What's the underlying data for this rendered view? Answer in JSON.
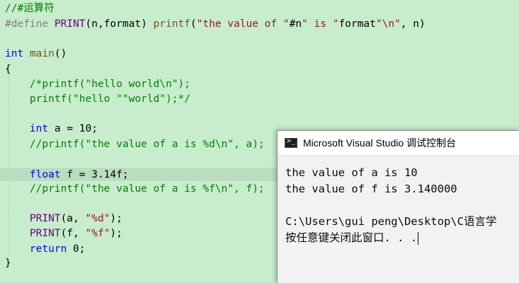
{
  "editor": {
    "lines": [
      {
        "tokens": [
          {
            "cls": "cm",
            "text": "//#运算符"
          }
        ]
      },
      {
        "tokens": [
          {
            "cls": "pp",
            "text": "#define "
          },
          {
            "cls": "mac",
            "text": "PRINT"
          },
          {
            "cls": "op",
            "text": "(n,format) "
          },
          {
            "cls": "fn",
            "text": "printf"
          },
          {
            "cls": "op",
            "text": "("
          },
          {
            "cls": "str",
            "text": "\"the value of \""
          },
          {
            "cls": "op",
            "text": "#n"
          },
          {
            "cls": "str",
            "text": "\" is \""
          },
          {
            "cls": "op",
            "text": "format"
          },
          {
            "cls": "str",
            "text": "\"\\n\""
          },
          {
            "cls": "op",
            "text": ", n)"
          }
        ]
      },
      {
        "tokens": []
      },
      {
        "tokens": [
          {
            "cls": "kw",
            "text": "int"
          },
          {
            "cls": "op",
            "text": " "
          },
          {
            "cls": "fn",
            "text": "main"
          },
          {
            "cls": "op",
            "text": "()"
          }
        ]
      },
      {
        "tokens": [
          {
            "cls": "op",
            "text": "{"
          }
        ]
      },
      {
        "tokens": [
          {
            "cls": "cm",
            "text": "    /*printf(\"hello world\\n\");"
          }
        ]
      },
      {
        "tokens": [
          {
            "cls": "cm",
            "text": "    printf(\"hello \"\"world\");*/"
          }
        ]
      },
      {
        "tokens": []
      },
      {
        "tokens": [
          {
            "cls": "op",
            "text": "    "
          },
          {
            "cls": "kw",
            "text": "int"
          },
          {
            "cls": "op",
            "text": " a = 10;"
          }
        ]
      },
      {
        "tokens": [
          {
            "cls": "cm",
            "text": "    //printf(\"the value of a is %d\\n\", a);"
          }
        ]
      },
      {
        "tokens": []
      },
      {
        "tokens": [
          {
            "cls": "op",
            "text": "    "
          },
          {
            "cls": "kw",
            "text": "float"
          },
          {
            "cls": "op",
            "text": " f = 3.14f;"
          }
        ],
        "highlight": true
      },
      {
        "tokens": [
          {
            "cls": "cm",
            "text": "    //printf(\"the value of a is %f\\n\", f);"
          }
        ]
      },
      {
        "tokens": []
      },
      {
        "tokens": [
          {
            "cls": "op",
            "text": "    "
          },
          {
            "cls": "mac",
            "text": "PRINT"
          },
          {
            "cls": "op",
            "text": "(a, "
          },
          {
            "cls": "str",
            "text": "\"%d\""
          },
          {
            "cls": "op",
            "text": ");"
          }
        ]
      },
      {
        "tokens": [
          {
            "cls": "op",
            "text": "    "
          },
          {
            "cls": "mac",
            "text": "PRINT"
          },
          {
            "cls": "op",
            "text": "(f, "
          },
          {
            "cls": "str",
            "text": "\"%f\""
          },
          {
            "cls": "op",
            "text": ");"
          }
        ]
      },
      {
        "tokens": [
          {
            "cls": "op",
            "text": "    "
          },
          {
            "cls": "kw",
            "text": "return"
          },
          {
            "cls": "op",
            "text": " 0;"
          }
        ]
      },
      {
        "tokens": [
          {
            "cls": "op",
            "text": "}"
          }
        ]
      }
    ]
  },
  "console": {
    "title": "Microsoft Visual Studio 调试控制台",
    "icon": "console-icon",
    "lines": [
      "the value of a is 10",
      "the value of f is 3.140000",
      "",
      "C:\\Users\\gui peng\\Desktop\\C语言学",
      "按任意键关闭此窗口. . ."
    ]
  },
  "colors": {
    "editor_background": "#c7edcc",
    "keyword": "#0000ff",
    "comment": "#008000",
    "preprocessor": "#808080",
    "macro": "#6f008a",
    "string": "#a31515",
    "function": "#74531f",
    "console_background": "#f2f2f2"
  }
}
